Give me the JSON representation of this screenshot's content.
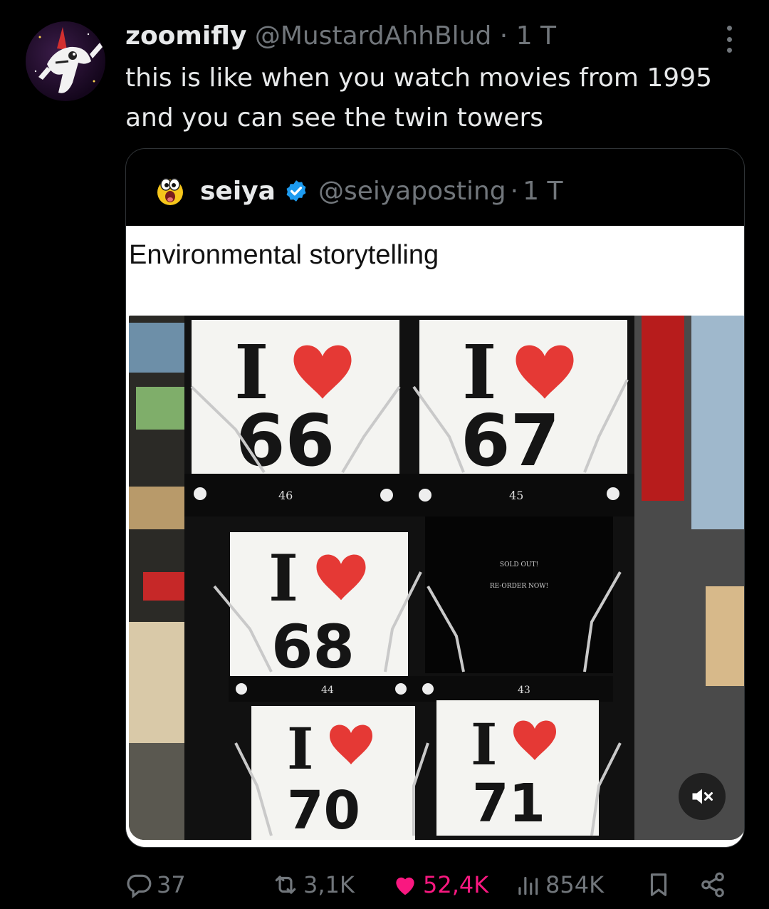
{
  "post": {
    "author_name": "zoomifly",
    "author_handle": "@MustardAhhBlud",
    "separator": "·",
    "time": "1 T",
    "text": "this is like when you watch movies from 1995 and you can see the twin towers"
  },
  "quoted": {
    "author_name": "seiya",
    "author_handle": "@seiyaposting",
    "separator": "·",
    "time": "1 T",
    "caption": "Environmental storytelling",
    "cards": {
      "c66": "66",
      "c67": "67",
      "c68": "68",
      "c70": "70",
      "c71": "71",
      "letter": "I",
      "label_46": "46",
      "label_45": "45",
      "label_44": "44",
      "label_43": "43",
      "sold_out": "SOLD OUT!",
      "reorder": "RE-ORDER NOW!"
    }
  },
  "actions": {
    "replies": "37",
    "reposts": "3,1K",
    "likes": "52,4K",
    "views": "854K"
  },
  "colors": {
    "like_pink": "#f91880",
    "muted_gray": "#71767b",
    "verified_blue": "#1d9bf0",
    "heart_red": "#e53935"
  }
}
